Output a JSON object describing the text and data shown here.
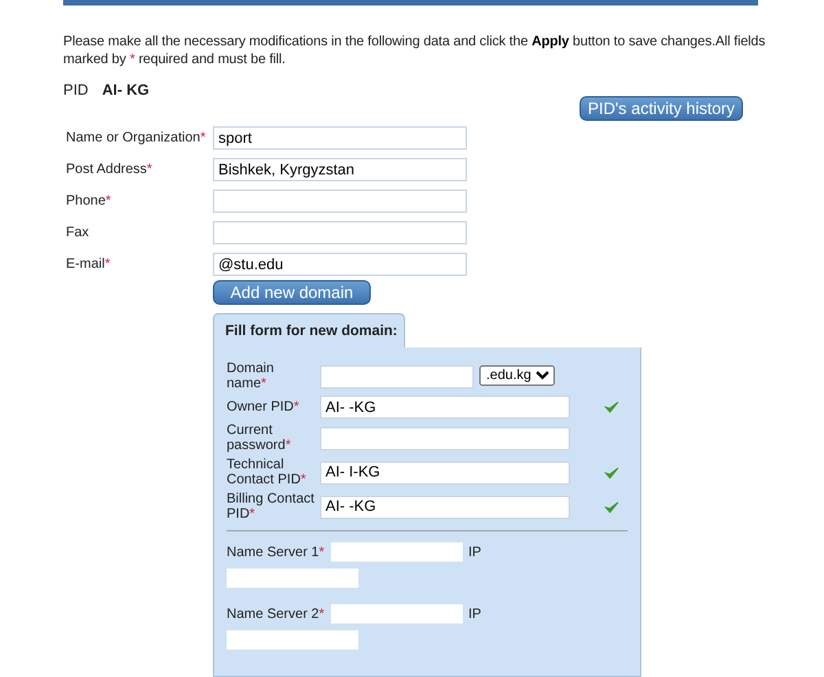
{
  "intro": {
    "before": "Please make all the necessary modifications in the following data and click the ",
    "bold": "Apply",
    "after": " button to save changes.All fields marked by ",
    "star": "*",
    "end": " required and must be fill."
  },
  "pid": {
    "label": "PID",
    "value": "AI- KG"
  },
  "history_button": "PID's activity history",
  "fields": [
    {
      "label": "Name or Organization",
      "required": true,
      "value": "sport"
    },
    {
      "label": "Post Address",
      "required": true,
      "value": "Bishkek, Kyrgyzstan"
    },
    {
      "label": "Phone",
      "required": true
    },
    {
      "label": "Fax",
      "required": false
    },
    {
      "label": "E-mail",
      "required": true,
      "value": "@stu.edu"
    }
  ],
  "add_domain_button": "Add new domain",
  "domain_form": {
    "tab": "Fill form for new domain:",
    "rows": [
      {
        "kind": "select",
        "label": "Domain name",
        "required": true,
        "option": ".edu.kg"
      },
      {
        "kind": "text",
        "label": "Owner PID",
        "required": true,
        "value": "AI- -KG",
        "valid": true
      },
      {
        "kind": "text",
        "label": "Current password",
        "required": true,
        "valid": false
      },
      {
        "kind": "text",
        "label": "Technical Contact PID",
        "required": true,
        "value": "AI- I-KG",
        "valid": true
      },
      {
        "kind": "text",
        "label": "Billing Contact PID",
        "required": true,
        "value": "AI- -KG",
        "valid": true
      }
    ],
    "servers": [
      {
        "label": "Name Server 1",
        "required": true,
        "ip_label": "IP"
      },
      {
        "label": "Name Server 2",
        "required": true,
        "ip_label": "IP"
      }
    ]
  }
}
